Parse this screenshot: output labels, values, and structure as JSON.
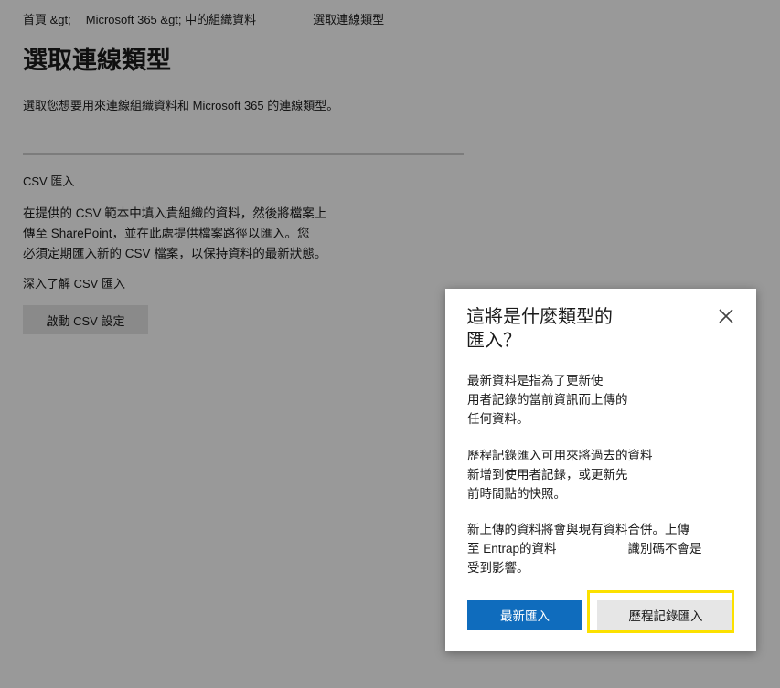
{
  "breadcrumb": {
    "home": "首頁 &gt;",
    "parent": "Microsoft 365 &gt; 中的組織資料",
    "current": "選取連線類型"
  },
  "page": {
    "title": "選取連線類型",
    "subtitle": "選取您想要用來連線組織資料和 Microsoft 365 的連線類型。"
  },
  "csv_section": {
    "title": "CSV 匯入",
    "description_lines": [
      "在提供的 CSV 範本中填入貴組織的資料，然後將檔案上",
      "傳至 SharePoint，並在此處提供檔案路徑以匯入。您",
      "必須定期匯入新的 CSV 檔案，以保持資料的最新狀態。"
    ],
    "learn_more": "深入了解 CSV 匯入",
    "start_button": "啟動 CSV 設定"
  },
  "dialog": {
    "title_lines": [
      "這將是什麼類型的",
      "匯入？"
    ],
    "close_icon": "close-icon",
    "paragraph1_lines": [
      "最新資料是指為了更新使",
      "用者記錄的當前資訊而上傳的",
      "任何資料。"
    ],
    "paragraph2_lines": [
      "歷程記錄匯入可用來將過去的資料",
      "新增到使用者記錄，或更新先",
      "前時間點的快照。"
    ],
    "paragraph3": {
      "line1": "新上傳的資料將會與現有資料合併。上傳",
      "line2_start": "至 Entrap的資料",
      "line2_end": "識別碼不會是",
      "line3": "受到影響。"
    },
    "latest_button": "最新匯入",
    "history_button": "歷程記錄匯入"
  },
  "colors": {
    "primary_button": "#0f6cbd",
    "highlight": "#fce100",
    "overlay": "rgba(0,0,0,0.40)"
  }
}
